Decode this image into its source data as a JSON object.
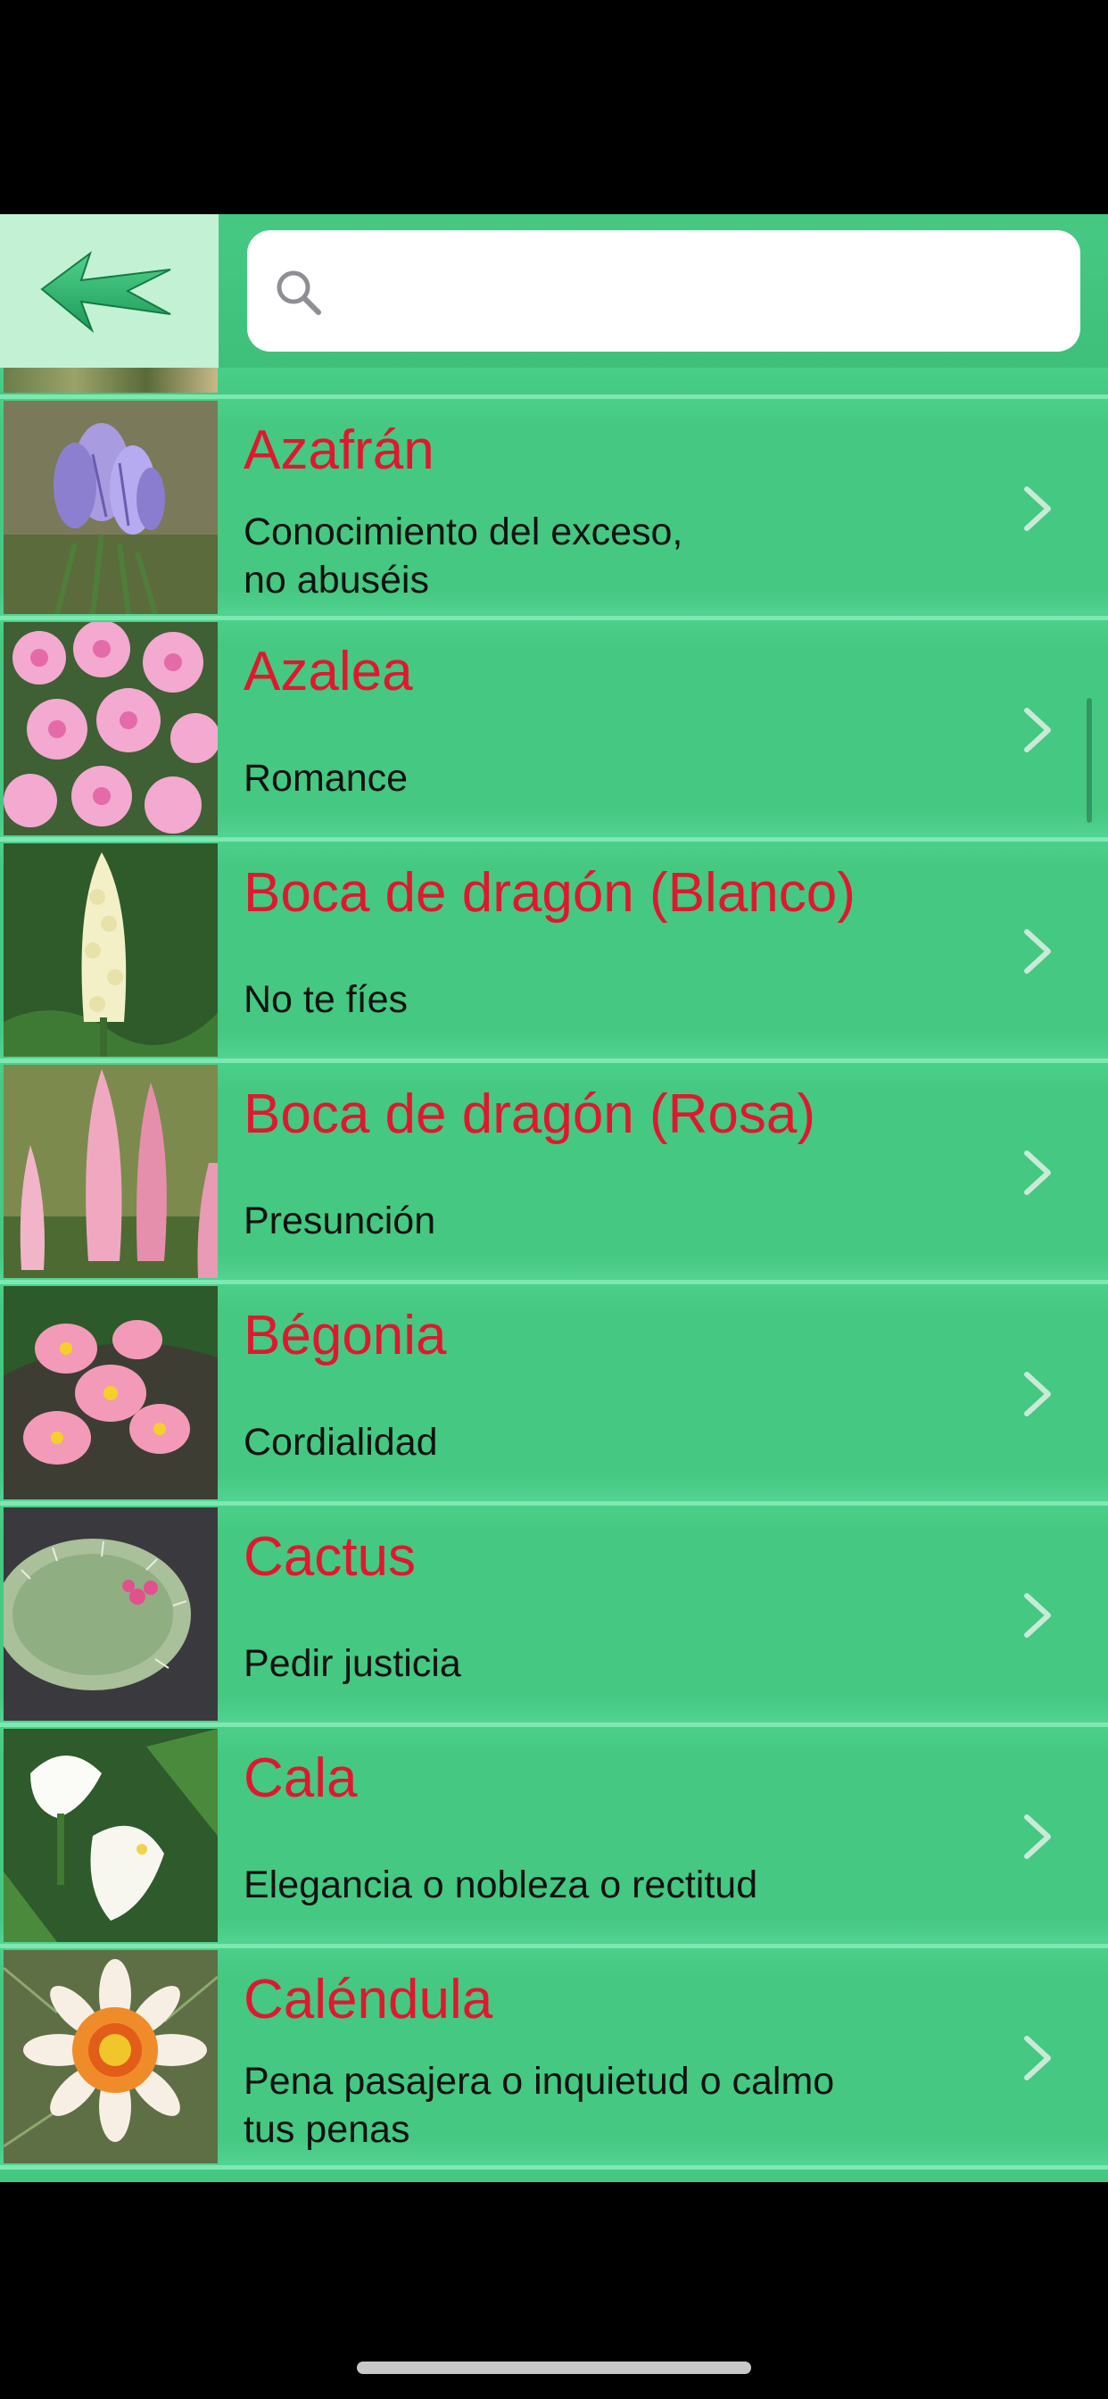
{
  "header": {
    "back_label": "",
    "search_placeholder": "",
    "search_value": ""
  },
  "colors": {
    "background": "#45c882",
    "title": "#e0182e",
    "back_button_bg": "#c3f1d3"
  },
  "list": {
    "items": [
      {
        "title": "Azafrán",
        "subtitle": "Conocimiento del exceso,\nno abuséis",
        "image": "crocus"
      },
      {
        "title": "Azalea",
        "subtitle": "Romance",
        "image": "azalea"
      },
      {
        "title": "Boca de dragón (Blanco)",
        "subtitle": "No te fíes",
        "image": "white-lupine"
      },
      {
        "title": "Boca de dragón (Rosa)",
        "subtitle": "Presunción",
        "image": "pink-lupine"
      },
      {
        "title": "Bégonia",
        "subtitle": "Cordialidad",
        "image": "begonia"
      },
      {
        "title": "Cactus",
        "subtitle": "Pedir justicia",
        "image": "cactus"
      },
      {
        "title": "Cala",
        "subtitle": "Elegancia o nobleza o rectitud",
        "image": "calla"
      },
      {
        "title": "Caléndula",
        "subtitle": "Pena pasajera o inquietud o calmo\ntus penas",
        "image": "gazania"
      }
    ]
  },
  "icons": {
    "back": "back-arrow-icon",
    "search": "search-icon",
    "chevron": "chevron-right-icon"
  }
}
